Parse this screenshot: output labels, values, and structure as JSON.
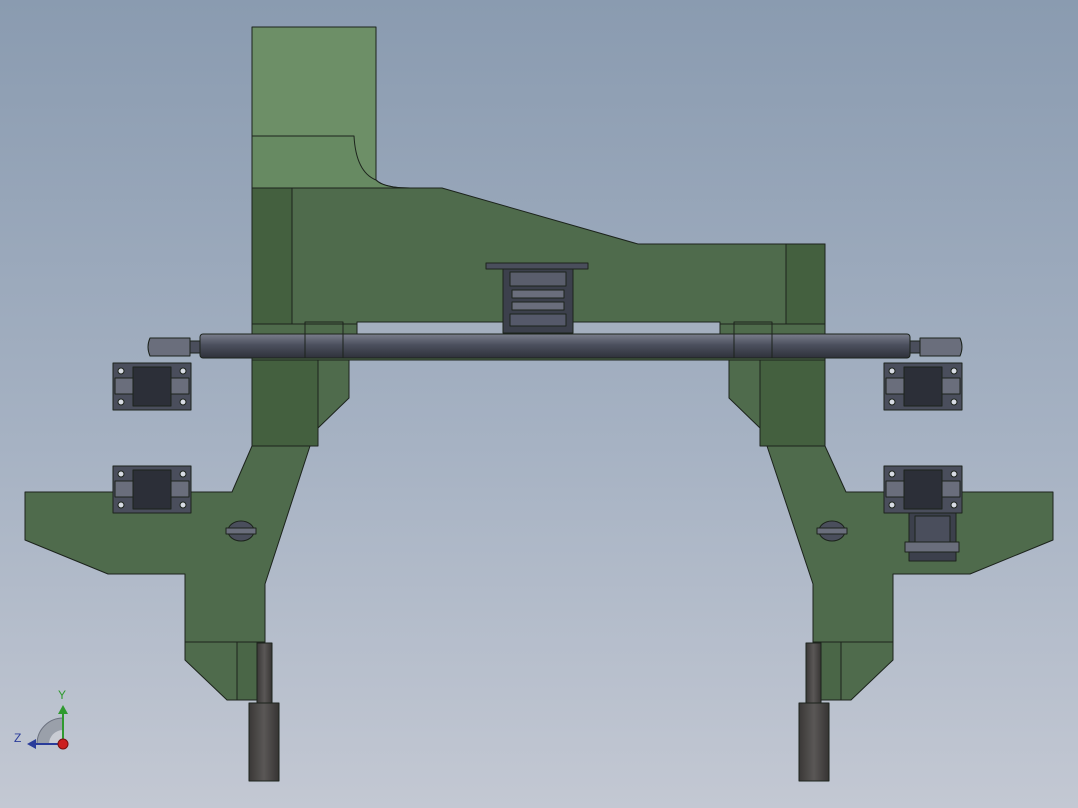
{
  "colors": {
    "body_green": "#4f6b4c",
    "body_green_light": "#6d8f67",
    "body_green_dark": "#44603f",
    "outline": "#1c231c",
    "steel": "#4a4e5c",
    "steel_light": "#6a6e7c",
    "steel_dark": "#2c2f38",
    "pin": "#4b4847",
    "axis_x": "#cc1f1f",
    "axis_y": "#2f9a2f",
    "axis_z": "#2a3c9a"
  },
  "triad": {
    "y_label": "Y",
    "z_label": "Z"
  }
}
